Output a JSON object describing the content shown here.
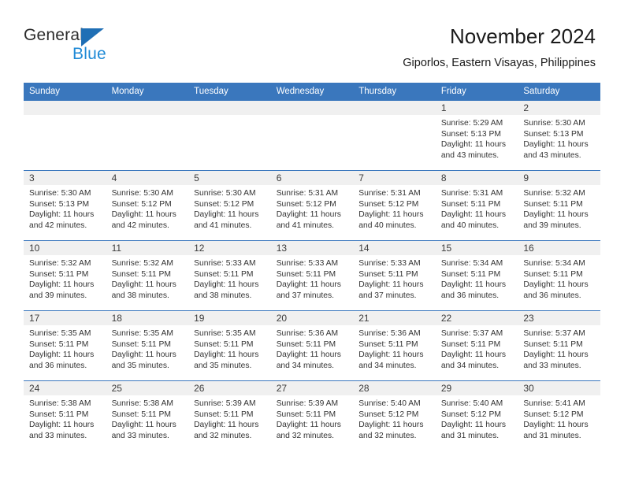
{
  "brand": {
    "name_part1": "General",
    "name_part2": "Blue",
    "logo_icon": "triangle-icon",
    "accent_dark": "#1f6fb5",
    "accent_light": "#1f8ad6"
  },
  "header": {
    "title": "November 2024",
    "subtitle": "Giporlos, Eastern Visayas, Philippines"
  },
  "colors": {
    "header_row_bg": "#3a77bd",
    "daynum_bg": "#f0f0f0",
    "cell_border": "#3a77bd",
    "text": "#333333"
  },
  "weekdays": [
    "Sunday",
    "Monday",
    "Tuesday",
    "Wednesday",
    "Thursday",
    "Friday",
    "Saturday"
  ],
  "weeks": [
    [
      {
        "day": "",
        "lines": []
      },
      {
        "day": "",
        "lines": []
      },
      {
        "day": "",
        "lines": []
      },
      {
        "day": "",
        "lines": []
      },
      {
        "day": "",
        "lines": []
      },
      {
        "day": "1",
        "lines": [
          "Sunrise: 5:29 AM",
          "Sunset: 5:13 PM",
          "Daylight: 11 hours",
          "and 43 minutes."
        ]
      },
      {
        "day": "2",
        "lines": [
          "Sunrise: 5:30 AM",
          "Sunset: 5:13 PM",
          "Daylight: 11 hours",
          "and 43 minutes."
        ]
      }
    ],
    [
      {
        "day": "3",
        "lines": [
          "Sunrise: 5:30 AM",
          "Sunset: 5:13 PM",
          "Daylight: 11 hours",
          "and 42 minutes."
        ]
      },
      {
        "day": "4",
        "lines": [
          "Sunrise: 5:30 AM",
          "Sunset: 5:12 PM",
          "Daylight: 11 hours",
          "and 42 minutes."
        ]
      },
      {
        "day": "5",
        "lines": [
          "Sunrise: 5:30 AM",
          "Sunset: 5:12 PM",
          "Daylight: 11 hours",
          "and 41 minutes."
        ]
      },
      {
        "day": "6",
        "lines": [
          "Sunrise: 5:31 AM",
          "Sunset: 5:12 PM",
          "Daylight: 11 hours",
          "and 41 minutes."
        ]
      },
      {
        "day": "7",
        "lines": [
          "Sunrise: 5:31 AM",
          "Sunset: 5:12 PM",
          "Daylight: 11 hours",
          "and 40 minutes."
        ]
      },
      {
        "day": "8",
        "lines": [
          "Sunrise: 5:31 AM",
          "Sunset: 5:11 PM",
          "Daylight: 11 hours",
          "and 40 minutes."
        ]
      },
      {
        "day": "9",
        "lines": [
          "Sunrise: 5:32 AM",
          "Sunset: 5:11 PM",
          "Daylight: 11 hours",
          "and 39 minutes."
        ]
      }
    ],
    [
      {
        "day": "10",
        "lines": [
          "Sunrise: 5:32 AM",
          "Sunset: 5:11 PM",
          "Daylight: 11 hours",
          "and 39 minutes."
        ]
      },
      {
        "day": "11",
        "lines": [
          "Sunrise: 5:32 AM",
          "Sunset: 5:11 PM",
          "Daylight: 11 hours",
          "and 38 minutes."
        ]
      },
      {
        "day": "12",
        "lines": [
          "Sunrise: 5:33 AM",
          "Sunset: 5:11 PM",
          "Daylight: 11 hours",
          "and 38 minutes."
        ]
      },
      {
        "day": "13",
        "lines": [
          "Sunrise: 5:33 AM",
          "Sunset: 5:11 PM",
          "Daylight: 11 hours",
          "and 37 minutes."
        ]
      },
      {
        "day": "14",
        "lines": [
          "Sunrise: 5:33 AM",
          "Sunset: 5:11 PM",
          "Daylight: 11 hours",
          "and 37 minutes."
        ]
      },
      {
        "day": "15",
        "lines": [
          "Sunrise: 5:34 AM",
          "Sunset: 5:11 PM",
          "Daylight: 11 hours",
          "and 36 minutes."
        ]
      },
      {
        "day": "16",
        "lines": [
          "Sunrise: 5:34 AM",
          "Sunset: 5:11 PM",
          "Daylight: 11 hours",
          "and 36 minutes."
        ]
      }
    ],
    [
      {
        "day": "17",
        "lines": [
          "Sunrise: 5:35 AM",
          "Sunset: 5:11 PM",
          "Daylight: 11 hours",
          "and 36 minutes."
        ]
      },
      {
        "day": "18",
        "lines": [
          "Sunrise: 5:35 AM",
          "Sunset: 5:11 PM",
          "Daylight: 11 hours",
          "and 35 minutes."
        ]
      },
      {
        "day": "19",
        "lines": [
          "Sunrise: 5:35 AM",
          "Sunset: 5:11 PM",
          "Daylight: 11 hours",
          "and 35 minutes."
        ]
      },
      {
        "day": "20",
        "lines": [
          "Sunrise: 5:36 AM",
          "Sunset: 5:11 PM",
          "Daylight: 11 hours",
          "and 34 minutes."
        ]
      },
      {
        "day": "21",
        "lines": [
          "Sunrise: 5:36 AM",
          "Sunset: 5:11 PM",
          "Daylight: 11 hours",
          "and 34 minutes."
        ]
      },
      {
        "day": "22",
        "lines": [
          "Sunrise: 5:37 AM",
          "Sunset: 5:11 PM",
          "Daylight: 11 hours",
          "and 34 minutes."
        ]
      },
      {
        "day": "23",
        "lines": [
          "Sunrise: 5:37 AM",
          "Sunset: 5:11 PM",
          "Daylight: 11 hours",
          "and 33 minutes."
        ]
      }
    ],
    [
      {
        "day": "24",
        "lines": [
          "Sunrise: 5:38 AM",
          "Sunset: 5:11 PM",
          "Daylight: 11 hours",
          "and 33 minutes."
        ]
      },
      {
        "day": "25",
        "lines": [
          "Sunrise: 5:38 AM",
          "Sunset: 5:11 PM",
          "Daylight: 11 hours",
          "and 33 minutes."
        ]
      },
      {
        "day": "26",
        "lines": [
          "Sunrise: 5:39 AM",
          "Sunset: 5:11 PM",
          "Daylight: 11 hours",
          "and 32 minutes."
        ]
      },
      {
        "day": "27",
        "lines": [
          "Sunrise: 5:39 AM",
          "Sunset: 5:11 PM",
          "Daylight: 11 hours",
          "and 32 minutes."
        ]
      },
      {
        "day": "28",
        "lines": [
          "Sunrise: 5:40 AM",
          "Sunset: 5:12 PM",
          "Daylight: 11 hours",
          "and 32 minutes."
        ]
      },
      {
        "day": "29",
        "lines": [
          "Sunrise: 5:40 AM",
          "Sunset: 5:12 PM",
          "Daylight: 11 hours",
          "and 31 minutes."
        ]
      },
      {
        "day": "30",
        "lines": [
          "Sunrise: 5:41 AM",
          "Sunset: 5:12 PM",
          "Daylight: 11 hours",
          "and 31 minutes."
        ]
      }
    ]
  ]
}
